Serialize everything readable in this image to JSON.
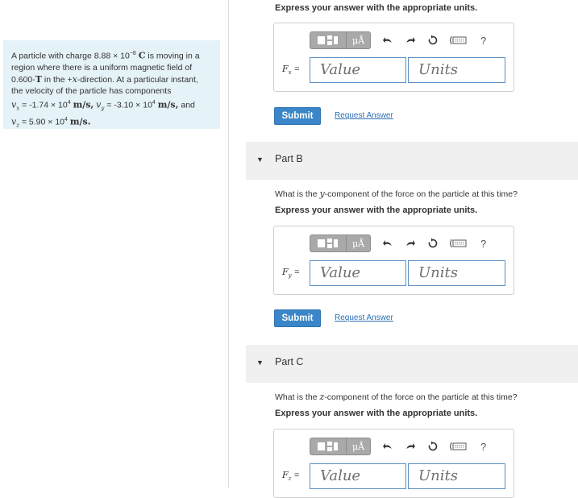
{
  "problem": {
    "line1_pre": "A particle with charge 8.88 ×",
    "charge_base": "10",
    "charge_exp": "−8",
    "charge_unit": "C",
    "line1_post": "is moving in a",
    "line2": "region where there is a uniform magnetic field of",
    "field_value": "0.600-",
    "field_unit": "T",
    "field_in": "in the +",
    "field_axis": "x",
    "field_post": "-direction. At a particular instant,",
    "line4": "the velocity of the particle has components",
    "vx_sym": "v",
    "vx_sub": "x",
    "vx_eq": "= -1.74 ×",
    "vx_base": "10",
    "vx_exp": "4",
    "vx_unit": "m/s,",
    "vy_sym": "v",
    "vy_sub": "y",
    "vy_eq": "= -3.10 ×",
    "vy_base": "10",
    "vy_exp": "4",
    "vy_unit": "m/s,",
    "and": "and",
    "vz_sym": "v",
    "vz_sub": "z",
    "vz_eq": "= 5.90 ×",
    "vz_base": "10",
    "vz_exp": "4",
    "vz_unit": "m/s."
  },
  "toolbar": {
    "units_btn": "μÅ",
    "help": "?",
    "icons": [
      "templates-icon",
      "units-icon",
      "undo-icon",
      "redo-icon",
      "reset-icon",
      "keyboard-icon",
      "help-icon"
    ]
  },
  "instruction": "Express your answer with the appropriate units.",
  "value_placeholder": "Value",
  "units_placeholder": "Units",
  "submit_label": "Submit",
  "request_label": "Request Answer",
  "partA": {
    "var": "F",
    "sub": "x",
    "eq": "="
  },
  "partB": {
    "title": "Part B",
    "q_pre": "What is the",
    "q_var": "y",
    "q_post": "-component of the force on the particle at this time?",
    "var": "F",
    "sub": "y",
    "eq": "="
  },
  "partC": {
    "title": "Part C",
    "q_pre": "What is the",
    "q_var": "z",
    "q_post": "-component of the force on the particle at this time?",
    "var": "F",
    "sub": "z",
    "eq": "="
  },
  "colors": {
    "accent": "#3a86c8",
    "problem_bg": "#e5f2f7",
    "toolbar_gray": "#a9a9a9"
  }
}
